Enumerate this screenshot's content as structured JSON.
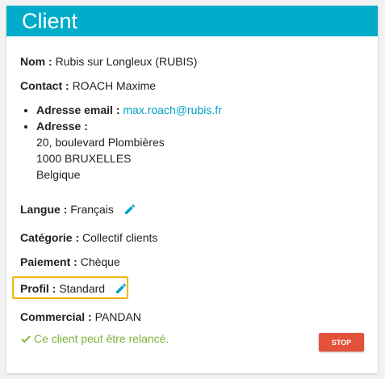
{
  "card": {
    "title": "Client"
  },
  "nom": {
    "label": "Nom :",
    "value": "Rubis sur Longleux (RUBIS)"
  },
  "contact": {
    "label": "Contact :",
    "value": "ROACH Maxime"
  },
  "email": {
    "label": "Adresse email :",
    "value": "max.roach@rubis.fr"
  },
  "adresse": {
    "label": "Adresse :",
    "lines": [
      "20, boulevard Plombières",
      "1000 BRUXELLES",
      "Belgique"
    ]
  },
  "langue": {
    "label": "Langue :",
    "value": "Français",
    "edit_icon": "pencil-icon"
  },
  "categorie": {
    "label": "Catégorie :",
    "value": "Collectif clients"
  },
  "paiement": {
    "label": "Paiement :",
    "value": "Chèque"
  },
  "profil": {
    "label": "Profil :",
    "value": "Standard",
    "edit_icon": "pencil-icon",
    "highlight_color": "#f5b400"
  },
  "commercial": {
    "label": "Commercial :",
    "value": "PANDAN"
  },
  "status": {
    "text": "Ce client peut être relancé.",
    "icon": "check-icon",
    "color": "#7cb13a"
  },
  "stop_button": {
    "label": "STOP",
    "color": "#e4513b"
  },
  "colors": {
    "header": "#00acc9",
    "link": "#00a2c6"
  }
}
